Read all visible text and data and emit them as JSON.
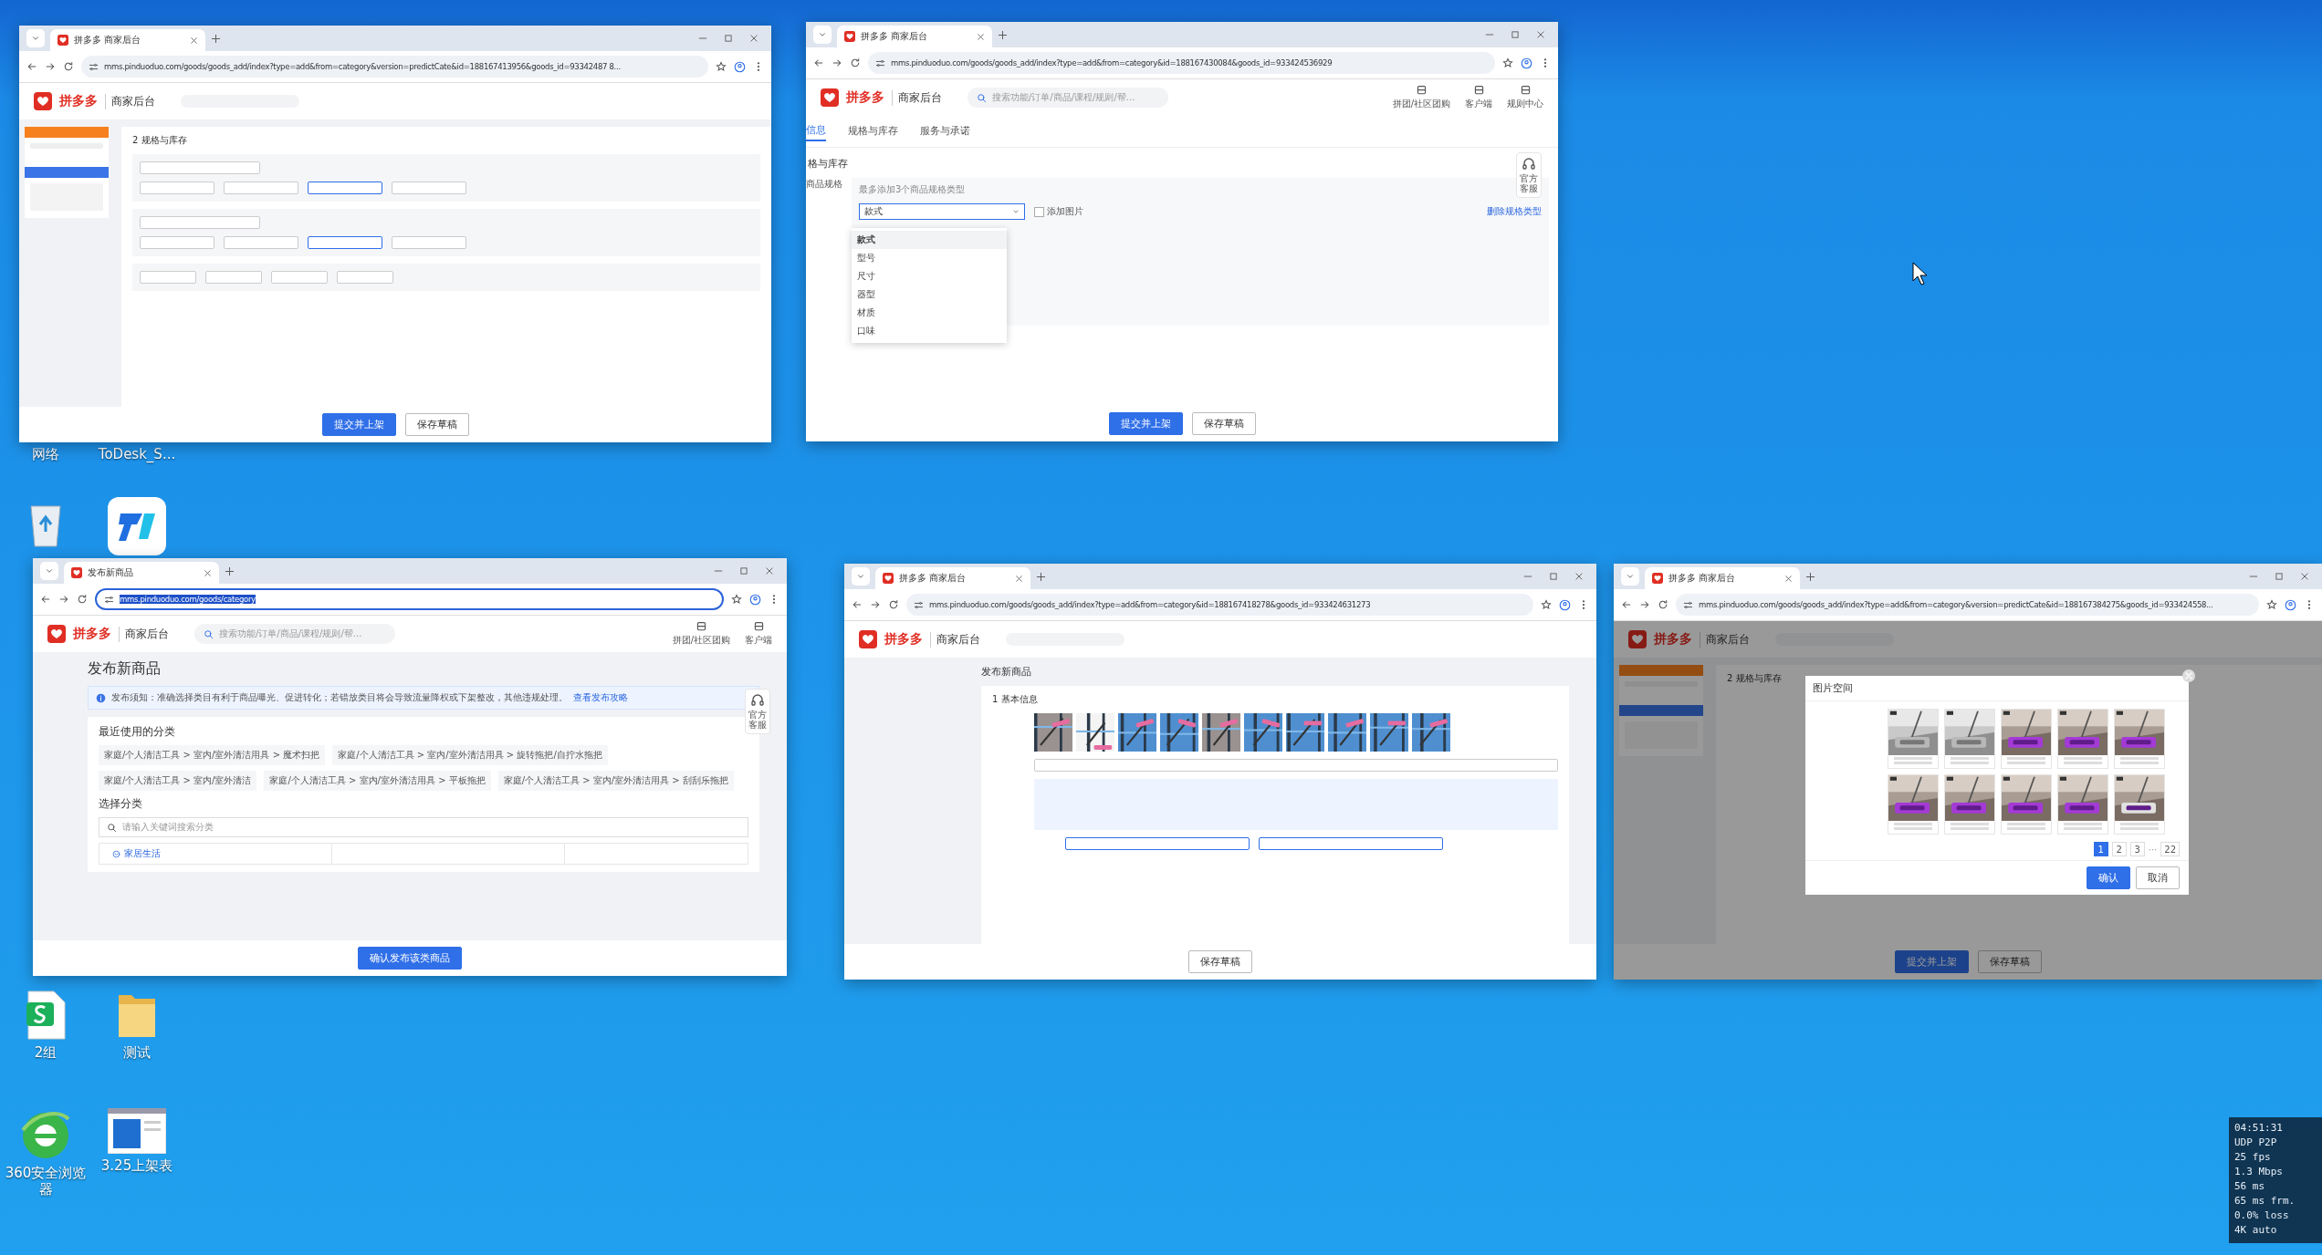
{
  "desktop_icons": [
    {
      "label": "网络"
    },
    {
      "label": "ToDesk_S..."
    },
    {
      "kind": "recycle_bin"
    },
    {
      "kind": "todesk"
    },
    {
      "kind": "sheet",
      "label": "2组"
    },
    {
      "kind": "folder",
      "label": "测试"
    },
    {
      "kind": "browser",
      "label": "360安全浏览器"
    },
    {
      "kind": "document",
      "label": "3.25上架表"
    }
  ],
  "windows": [
    {
      "kind": "spec_form",
      "tab_title": "拼多多 商家后台",
      "url": "mms.pinduoduo.com/goods/goods_add/index?type=add&from=category&version=predictCate&id=188167413956&goods_id=93342487 8...",
      "url_selected": false,
      "page": {
        "logo": "拼多多",
        "logo_sub": "商家后台",
        "section_title": "2 规格与库存",
        "buttons": [
          {
            "label": "提交并上架",
            "primary": true
          },
          {
            "label": "保存草稿",
            "primary": false
          }
        ]
      }
    },
    {
      "kind": "spec_dropdown",
      "tab_title": "拼多多 商家后台",
      "url": "mms.pinduoduo.com/goods/goods_add/index?type=add&from=category&id=188167430084&goods_id=933424536929",
      "url_selected": false,
      "page": {
        "logo": "拼多多",
        "logo_sub": "商家后台",
        "search_placeholder": "搜索功能/订单/商品/课程/规则/帮...",
        "header_links": [
          "拼团/社区团购",
          "客户端",
          "规则中心"
        ],
        "tabs": [
          {
            "label": "信息",
            "selected": true
          },
          {
            "label": "规格与库存",
            "selected": false
          },
          {
            "label": "服务与承诺",
            "selected": false
          }
        ],
        "section_title": "格与库存",
        "field_label": "商品规格",
        "hint": "最多添加3个商品规格类型",
        "select_value": "款式",
        "add_image": {
          "label": "添加图片",
          "checked": false
        },
        "delete_link": "删除规格类型",
        "options": [
          {
            "label": "款式",
            "selected": true
          },
          {
            "label": "型号",
            "selected": false
          },
          {
            "label": "尺寸",
            "selected": false
          },
          {
            "label": "器型",
            "selected": false
          },
          {
            "label": "材质",
            "selected": false
          },
          {
            "label": "口味",
            "selected": false
          }
        ],
        "service_label": "官方客服",
        "buttons": [
          {
            "label": "提交并上架",
            "primary": true
          },
          {
            "label": "保存草稿",
            "primary": false
          }
        ]
      }
    },
    {
      "kind": "category",
      "tab_title": "发布新商品",
      "url": "mms.pinduoduo.com/goods/category",
      "url_selected": true,
      "page": {
        "logo": "拼多多",
        "logo_sub": "商家后台",
        "search_placeholder": "搜索功能/订单/商品/课程/规则/帮...",
        "header_links": [
          "拼团/社区团购",
          "客户端"
        ],
        "heading": "发布新商品",
        "notice": "发布须知：准确选择类目有利于商品曝光、促进转化；若错放类目将会导致流量降权或下架整改，其他违规处理。",
        "notice_link": "查看发布攻略",
        "recent_title": "最近使用的分类",
        "recent": [
          "家庭/个人清洁工具 > 室内/室外清洁用具 > 魔术扫把",
          "家庭/个人清洁工具 > 室内/室外清洁用具 > 旋转拖把/自拧水拖把",
          "家庭/个人清洁工具 > 室内/室外清洁",
          "家庭/个人清洁工具 > 室内/室外清洁用具 > 平板拖把",
          "家庭/个人清洁工具 > 室内/室外清洁用具 > 刮刮乐拖把"
        ],
        "select_title": "选择分类",
        "category_search_placeholder": "请输入关键词搜索分类",
        "tree_items": [
          "家居生活"
        ],
        "service_label": "官方客服",
        "buttons": [
          {
            "label": "确认发布该类商品",
            "primary": true
          }
        ]
      }
    },
    {
      "kind": "basic_info",
      "tab_title": "拼多多 商家后台",
      "url": "mms.pinduoduo.com/goods/goods_add/index?type=add&from=category&id=188167418278&goods_id=933424631273",
      "url_selected": false,
      "page": {
        "logo": "拼多多",
        "logo_sub": "商家后台",
        "heading": "发布新商品",
        "section_title": "1 基本信息",
        "buttons": [
          {
            "label": "保存草稿",
            "primary": false
          }
        ]
      }
    },
    {
      "kind": "image_dialog",
      "tab_title": "拼多多 商家后台",
      "url": "mms.pinduoduo.com/goods/goods_add/index?type=add&from=category&version=predictCate&id=188167384275&goods_id=933424558...",
      "url_selected": false,
      "page": {
        "logo": "拼多多",
        "logo_sub": "商家后台",
        "dimmed": true,
        "section_title": "2 规格与库存",
        "dialog": {
          "title": "图片空间",
          "pages": [
            {
              "label": "1",
              "selected": true
            },
            {
              "label": "2",
              "selected": false
            },
            {
              "label": "3",
              "selected": false
            },
            {
              "label": "22",
              "selected": false
            }
          ],
          "more": "···",
          "confirm": "确认",
          "cancel": "取消"
        },
        "buttons": [
          {
            "label": "提交并上架",
            "primary": true
          },
          {
            "label": "保存草稿",
            "primary": false
          }
        ]
      }
    }
  ],
  "stats": [
    "04:51:31",
    "UDP P2P",
    "25 fps",
    "1.3 Mbps",
    "56 ms",
    "65 ms frm.",
    "0.0% loss",
    "4K auto"
  ]
}
